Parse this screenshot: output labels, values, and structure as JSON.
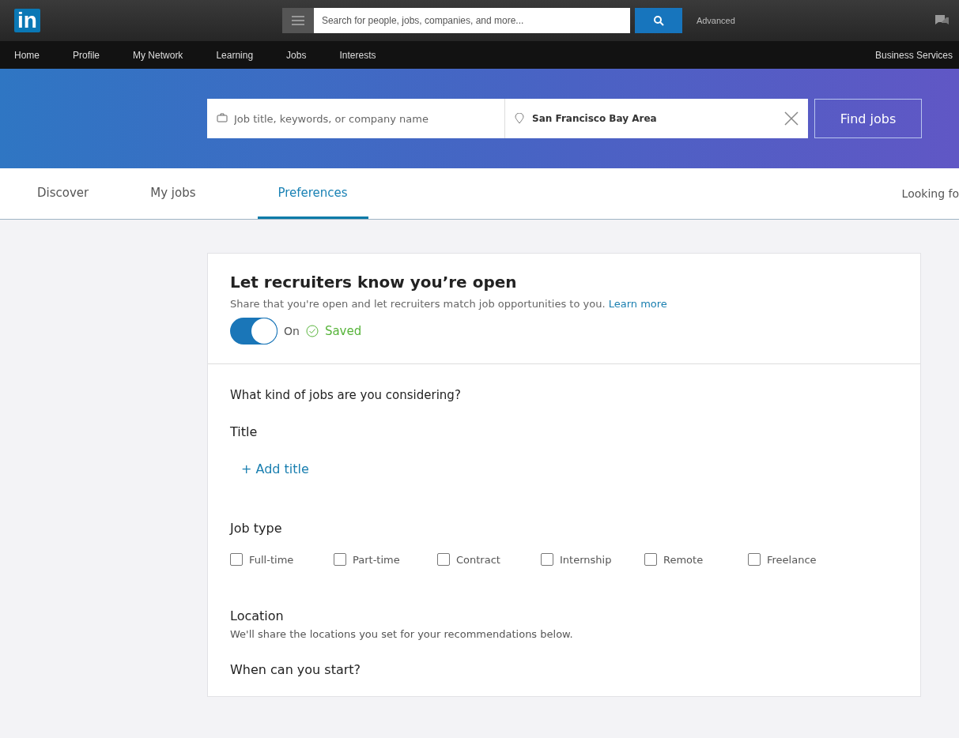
{
  "top_bar": {
    "logo": "in",
    "search": {
      "placeholder": "Search for people, jobs, companies, and more..."
    },
    "advanced": "Advanced"
  },
  "nav": {
    "items": [
      "Home",
      "Profile",
      "My Network",
      "Learning",
      "Jobs",
      "Interests"
    ],
    "right": "Business Services"
  },
  "job_search": {
    "keywords": {
      "placeholder": "Job title, keywords, or company name"
    },
    "location": {
      "value": "San Francisco Bay Area"
    },
    "button": "Find jobs"
  },
  "tabs": [
    {
      "label": "Discover",
      "selected": false
    },
    {
      "label": "My jobs",
      "selected": false
    },
    {
      "label": "Preferences",
      "selected": true
    }
  ],
  "tabs_right": "Looking fo",
  "open_card": {
    "title": "Let recruiters know you’re open",
    "description": "Share that you're open and let recruiters match job opportunities to you.",
    "link": "Learn more",
    "toggle": {
      "on": true,
      "label": "On"
    },
    "status": "Saved"
  },
  "preferences": {
    "question": "What kind of jobs are you considering?",
    "title_label": "Title",
    "add_title": "+ Add title",
    "job_type_label": "Job type",
    "job_types": [
      {
        "label": "Full-time",
        "checked": false
      },
      {
        "label": "Part-time",
        "checked": false
      },
      {
        "label": "Contract",
        "checked": false
      },
      {
        "label": "Internship",
        "checked": false
      },
      {
        "label": "Remote",
        "checked": false
      },
      {
        "label": "Freelance",
        "checked": false
      }
    ],
    "location_label": "Location",
    "location_hint": "We'll share the locations you set for your recommendations below.",
    "next_question": "When can you start?"
  }
}
